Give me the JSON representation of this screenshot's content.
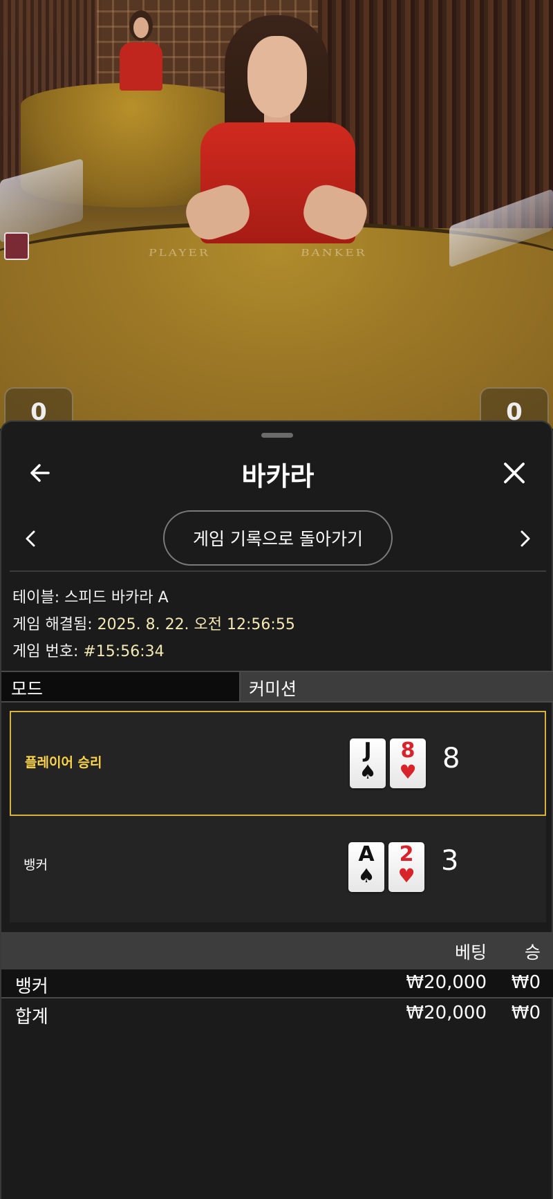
{
  "video": {
    "table_labels": {
      "player": "PLAYER",
      "banker": "BANKER"
    },
    "score_left": "0",
    "score_right": "0"
  },
  "header": {
    "title": "바카라",
    "back_icon": "arrow-left-icon",
    "close_icon": "close-icon"
  },
  "nav": {
    "prev_icon": "chevron-left-icon",
    "next_icon": "chevron-right-icon",
    "back_to_history_label": "게임 기록으로 돌아가기"
  },
  "game_info": {
    "table_label": "테이블:",
    "table_value": "스피드 바카라 A",
    "resolved_label": "게임 해결됨:",
    "resolved_value": "2025. 8. 22. 오전 12:56:55",
    "number_label": "게임 번호:",
    "number_value": "#15:56:34"
  },
  "mode": {
    "label": "모드",
    "value": "커미션"
  },
  "hands": {
    "player": {
      "label": "플레이어 승리",
      "cards": [
        {
          "rank": "J",
          "suit": "♠",
          "color": "#111111"
        },
        {
          "rank": "8",
          "suit": "♥",
          "color": "#d8232a"
        }
      ],
      "score": "8"
    },
    "banker": {
      "label": "뱅커",
      "cards": [
        {
          "rank": "A",
          "suit": "♠",
          "color": "#111111"
        },
        {
          "rank": "2",
          "suit": "♥",
          "color": "#d8232a"
        }
      ],
      "score": "3"
    }
  },
  "bets": {
    "headers": {
      "bet": "베팅",
      "win": "승"
    },
    "rows": [
      {
        "name": "뱅커",
        "bet": "₩20,000",
        "win": "₩0"
      },
      {
        "name": "합계",
        "bet": "₩20,000",
        "win": "₩0"
      }
    ]
  },
  "colors": {
    "accent_gold": "#d9b43c",
    "winner_text": "#ffd54a",
    "sheet_bg": "#1b1b1b"
  }
}
